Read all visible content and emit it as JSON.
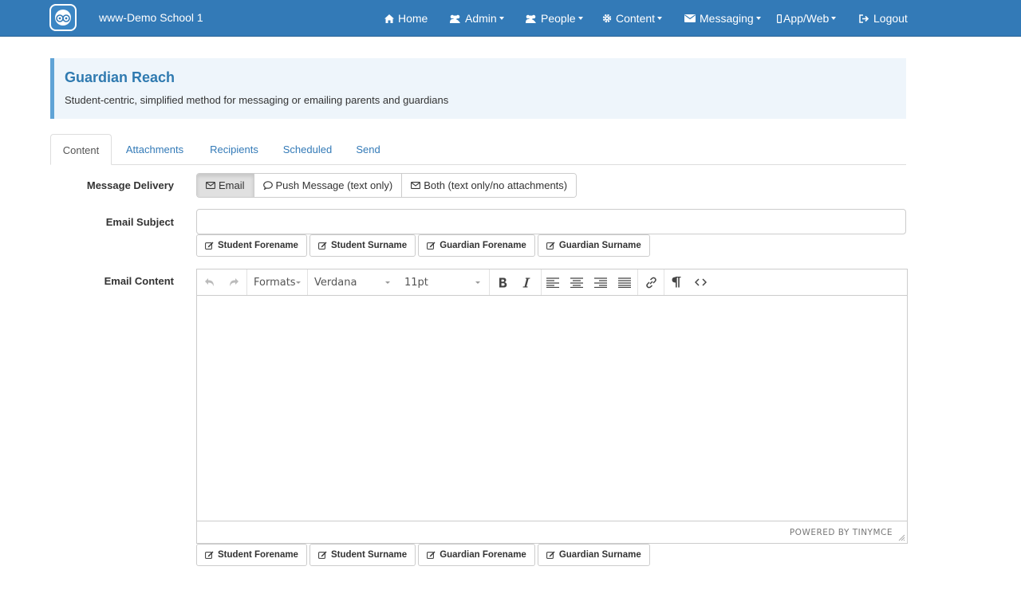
{
  "navbar": {
    "brand": "www-Demo School 1",
    "items": [
      {
        "label": "Home",
        "icon": "home-icon"
      },
      {
        "label": "Admin",
        "icon": "users-icon"
      },
      {
        "label": "People",
        "icon": "users-icon"
      },
      {
        "label": "Content",
        "icon": "gear-icon"
      },
      {
        "label": "Messaging",
        "icon": "envelope-icon"
      },
      {
        "label": "App/Web",
        "icon": "mobile-icon"
      },
      {
        "label": "Logout",
        "icon": "logout-icon"
      }
    ]
  },
  "header": {
    "title": "Guardian Reach",
    "subtitle": "Student-centric, simplified method for messaging or emailing parents and guardians"
  },
  "tabs": [
    "Content",
    "Attachments",
    "Recipients",
    "Scheduled",
    "Send"
  ],
  "form": {
    "delivery_label": "Message Delivery",
    "delivery_options": [
      "Email",
      "Push Message (text only)",
      "Both (text only/no attachments)"
    ],
    "subject_label": "Email Subject",
    "subject_value": "",
    "content_label": "Email Content",
    "tokens": [
      "Student Forename",
      "Student Surname",
      "Guardian Forename",
      "Guardian Surname"
    ]
  },
  "editor": {
    "formats": "Formats",
    "font": "Verdana",
    "size": "11pt",
    "powered_by": "POWERED BY TINYMCE"
  },
  "colors": {
    "navbar": "#337ab7",
    "panel_bg": "#eef5fb",
    "accent": "#2f7ab0"
  }
}
